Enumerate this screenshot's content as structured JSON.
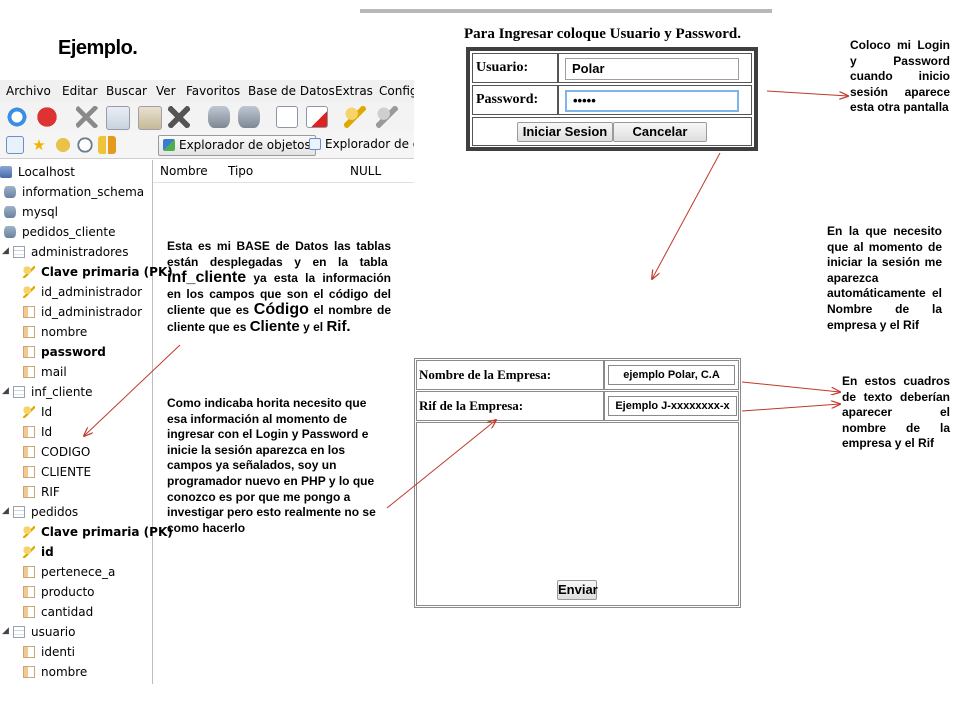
{
  "slide_title": "Ejemplo.",
  "db_tool": {
    "menu": [
      "Archivo",
      "Editar",
      "Buscar",
      "Ver",
      "Favoritos",
      "Base de Datos",
      "Extras",
      "Config"
    ],
    "tabs": {
      "object_explorer": "Explorador de objetos",
      "data_explorer": "Explorador de da"
    },
    "columns": [
      "Nombre",
      "Tipo",
      "NULL"
    ],
    "tree": {
      "server": "Localhost",
      "databases": [
        "information_schema",
        "mysql",
        "pedidos_cliente"
      ],
      "tables": {
        "administradores": {
          "name": "administradores",
          "fields": [
            "Clave primaria (PK)",
            "id_administrador",
            "id_administrador",
            "nombre",
            "password",
            "mail"
          ]
        },
        "inf_cliente": {
          "name": "inf_cliente",
          "fields": [
            "Id",
            "Id",
            "CODIGO",
            "CLIENTE",
            "RIF"
          ]
        },
        "pedidos": {
          "name": "pedidos",
          "fields": [
            "Clave primaria (PK)",
            "id",
            "pertenece_a",
            "producto",
            "cantidad"
          ]
        },
        "usuario": {
          "name": "usuario",
          "fields": [
            "identi",
            "nombre"
          ]
        }
      }
    }
  },
  "notes": {
    "db_1": "Esta es mi BASE de Datos las tablas están desplegadas y en la",
    "db_2": "tabla",
    "db_3": "inf_cliente",
    "db_4": "ya esta la información en los campos que son el código del cliente que es",
    "db_5": "Código",
    "db_6": "el nombre de cliente que es",
    "db_7": "Cliente",
    "db_8": "y el",
    "db_9": "Rif.",
    "explain": "Como indicaba horita necesito que esa información al momento de ingresar con el Login y Password e inicie la sesión aparezca en los campos ya señalados, soy un programador nuevo en PHP y lo que conozco es por que me pongo a investigar pero esto realmente no se como hacerlo",
    "login_note": "Coloco mi Login y Password cuando inicio sesión aparece esta otra pantalla",
    "session_note": "En la que necesito que al momento de iniciar la sesión me aparezca automáticamente el Nombre de la empresa y el Rif",
    "boxes_note": "En estos cuadros de texto deberían aparecer el nombre de la empresa y el Rif"
  },
  "login": {
    "title": "Para Ingresar coloque Usuario y Password.",
    "user_label": "Usuario:",
    "user_value": "Polar",
    "password_label": "Password:",
    "password_value": "•••••",
    "login_button": "Iniciar Sesion",
    "cancel_button": "Cancelar"
  },
  "empresa_form": {
    "name_label": "Nombre de la Empresa:",
    "name_value": "ejemplo Polar, C.A",
    "rif_label": "Rif de la Empresa:",
    "rif_value": "Ejemplo J-xxxxxxxx-x",
    "submit_button": "Enviar"
  },
  "colors": {
    "arrow": "#c0392b",
    "selection": "#d9e8fb",
    "dialog_border": "#3f3f3f"
  }
}
